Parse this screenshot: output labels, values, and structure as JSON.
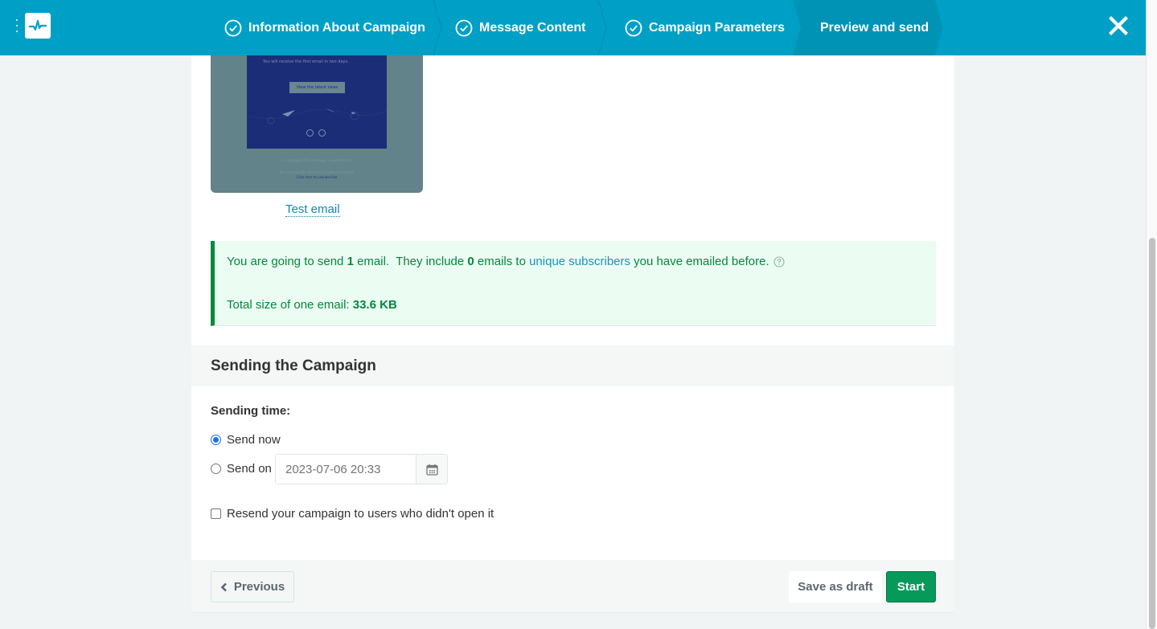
{
  "header": {
    "steps": [
      {
        "label": "Information About Campaign",
        "completed": true
      },
      {
        "label": "Message Content",
        "completed": true
      },
      {
        "label": "Campaign Parameters",
        "completed": true
      },
      {
        "label": "Preview and send",
        "completed": false,
        "active": true
      }
    ],
    "colors": {
      "bar": "#00a0c6",
      "active_step": "#0093b6"
    }
  },
  "preview": {
    "thumbnail": {
      "line": "You will receive the first email in two days.",
      "button": "View the latest news",
      "footer_lines": [
        "© Copyright 2023, example • example.com",
        "You received this email as a client of example.",
        "Click here to unsubscribe"
      ]
    },
    "test_email_link": "Test email"
  },
  "notice": {
    "text1": "You are going to send ",
    "count": "1",
    "text2": " email.  They include ",
    "unique_count": "0",
    "text3": " emails to ",
    "link": "unique subscribers",
    "text4": " you have emailed before.",
    "size_label": "Total size of one email: ",
    "size_value": "33.6 KB"
  },
  "sending": {
    "title": "Sending the Campaign",
    "time_label": "Sending time:",
    "options": [
      {
        "label": "Send now",
        "selected": true
      },
      {
        "label": "Send on",
        "selected": false
      }
    ],
    "date_placeholder": "2023-07-06 20:33",
    "resend_label": "Resend your campaign to users who didn't open it",
    "resend_checked": false
  },
  "footer": {
    "previous": "Previous",
    "save_draft": "Save as draft",
    "start": "Start"
  }
}
